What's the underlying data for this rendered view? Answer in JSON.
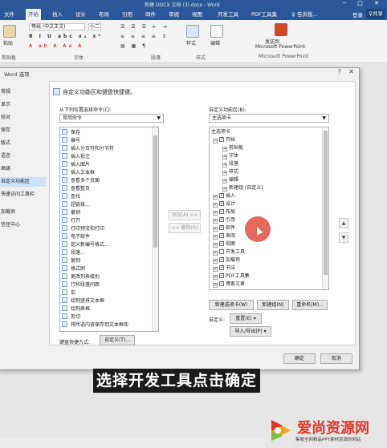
{
  "window": {
    "title": "新建 DOCX 文档 (3).docx - Word",
    "controls": [
      "─",
      "□",
      "✕"
    ]
  },
  "tabs": [
    "开始",
    "插入",
    "设计",
    "布局",
    "引用",
    "邮件",
    "审阅",
    "视图",
    "开发工具",
    "PDF工具集",
    "♀ 告诉我..."
  ],
  "active_tab": "开始",
  "account": {
    "login": "登录",
    "share": "♀共享"
  },
  "ribbon": {
    "font_name": "等线 (中文正文)",
    "font_size": "小二",
    "groups": {
      "clipboard": "剪贴板",
      "font": "字体",
      "paragraph": "段落",
      "styles": "样式",
      "editing": "编辑",
      "ppt": "Microsoft PowerPoint"
    },
    "buttons": {
      "paste": "粘贴",
      "style": "样式",
      "edit": "编辑",
      "ppt_btn": "发送到\nMicrosoft PowerPoint"
    }
  },
  "dialog": {
    "title": "Word 选项",
    "nav": [
      "常规",
      "显示",
      "校对",
      "保存",
      "版式",
      "语言",
      "高级",
      "自定义功能区",
      "快速访问工具栏",
      "加载项",
      "信任中心"
    ],
    "selected_nav": "自定义功能区",
    "heading": "自定义功能区和键盘快捷键。",
    "left_label": "从下列位置选择命令(C):",
    "left_dropdown": "常用命令",
    "right_label": "自定义功能区(B):",
    "right_dropdown": "主选项卡",
    "commands": [
      "保存",
      "编号",
      "插入分页符和分节符",
      "插入批注",
      "插入图片",
      "插入文本框",
      "查看多个页面",
      "查看整页",
      "查找",
      "超链接...",
      "撤销",
      "打开",
      "打印预览和打印",
      "电子邮件",
      "定义新编号格式...",
      "段落...",
      "复制",
      "格式刷",
      "更改列表级别",
      "行和段落间距",
      "宏",
      "绘制竖排文本框",
      "绘制表格",
      "剪切",
      "将所选内容保存到文本框库"
    ],
    "tree_header": "主选项卡",
    "tree": [
      {
        "label": "开始",
        "level": 0,
        "expand": "⊟",
        "checked": true
      },
      {
        "label": "剪贴板",
        "level": 1,
        "expand": "⊞"
      },
      {
        "label": "字体",
        "level": 1,
        "expand": "⊞"
      },
      {
        "label": "段落",
        "level": 1,
        "expand": "⊞"
      },
      {
        "label": "样式",
        "level": 1,
        "expand": "⊞"
      },
      {
        "label": "编辑",
        "level": 1,
        "expand": "⊞"
      },
      {
        "label": "新建组 (自定义)",
        "level": 1,
        "expand": "⊞"
      },
      {
        "label": "插入",
        "level": 0,
        "expand": "⊞",
        "checked": true
      },
      {
        "label": "设计",
        "level": 0,
        "expand": "⊞",
        "checked": true
      },
      {
        "label": "布局",
        "level": 0,
        "expand": "⊞",
        "checked": true
      },
      {
        "label": "引用",
        "level": 0,
        "expand": "⊞",
        "checked": true
      },
      {
        "label": "邮件",
        "level": 0,
        "expand": "⊞",
        "checked": true
      },
      {
        "label": "审阅",
        "level": 0,
        "expand": "⊞",
        "checked": true
      },
      {
        "label": "视图",
        "level": 0,
        "expand": "⊞",
        "checked": true
      },
      {
        "label": "开发工具",
        "level": 0,
        "expand": "⊞",
        "checked": false
      },
      {
        "label": "加载项",
        "level": 0,
        "expand": "⊞",
        "checked": true
      },
      {
        "label": "书法",
        "level": 0,
        "expand": "⊞",
        "checked": true
      },
      {
        "label": "PDF工具集",
        "level": 0,
        "expand": "⊞",
        "checked": true
      },
      {
        "label": "博客文章",
        "level": 0,
        "expand": "⊞",
        "checked": true
      }
    ],
    "add_button": "添加(A) >>",
    "remove_button": "<< 删除(R)",
    "new_tab_button": "新建选项卡(W)",
    "new_group_button": "新建组(N)",
    "rename_button": "重命名(M)...",
    "customize_label": "自定义:",
    "reset_button": "重置(E) ▾",
    "import_export_button": "导入/导出(P) ▾",
    "shortcut_label": "键盘快捷方式:",
    "shortcut_button": "自定义(T)...",
    "ok_button": "确定",
    "cancel_button": "取消"
  },
  "caption": "选择开发工具点击确定",
  "watermark": {
    "title": "爱尚资源网",
    "subtitle": "集聚全网精品PPT素材资源的网站"
  }
}
